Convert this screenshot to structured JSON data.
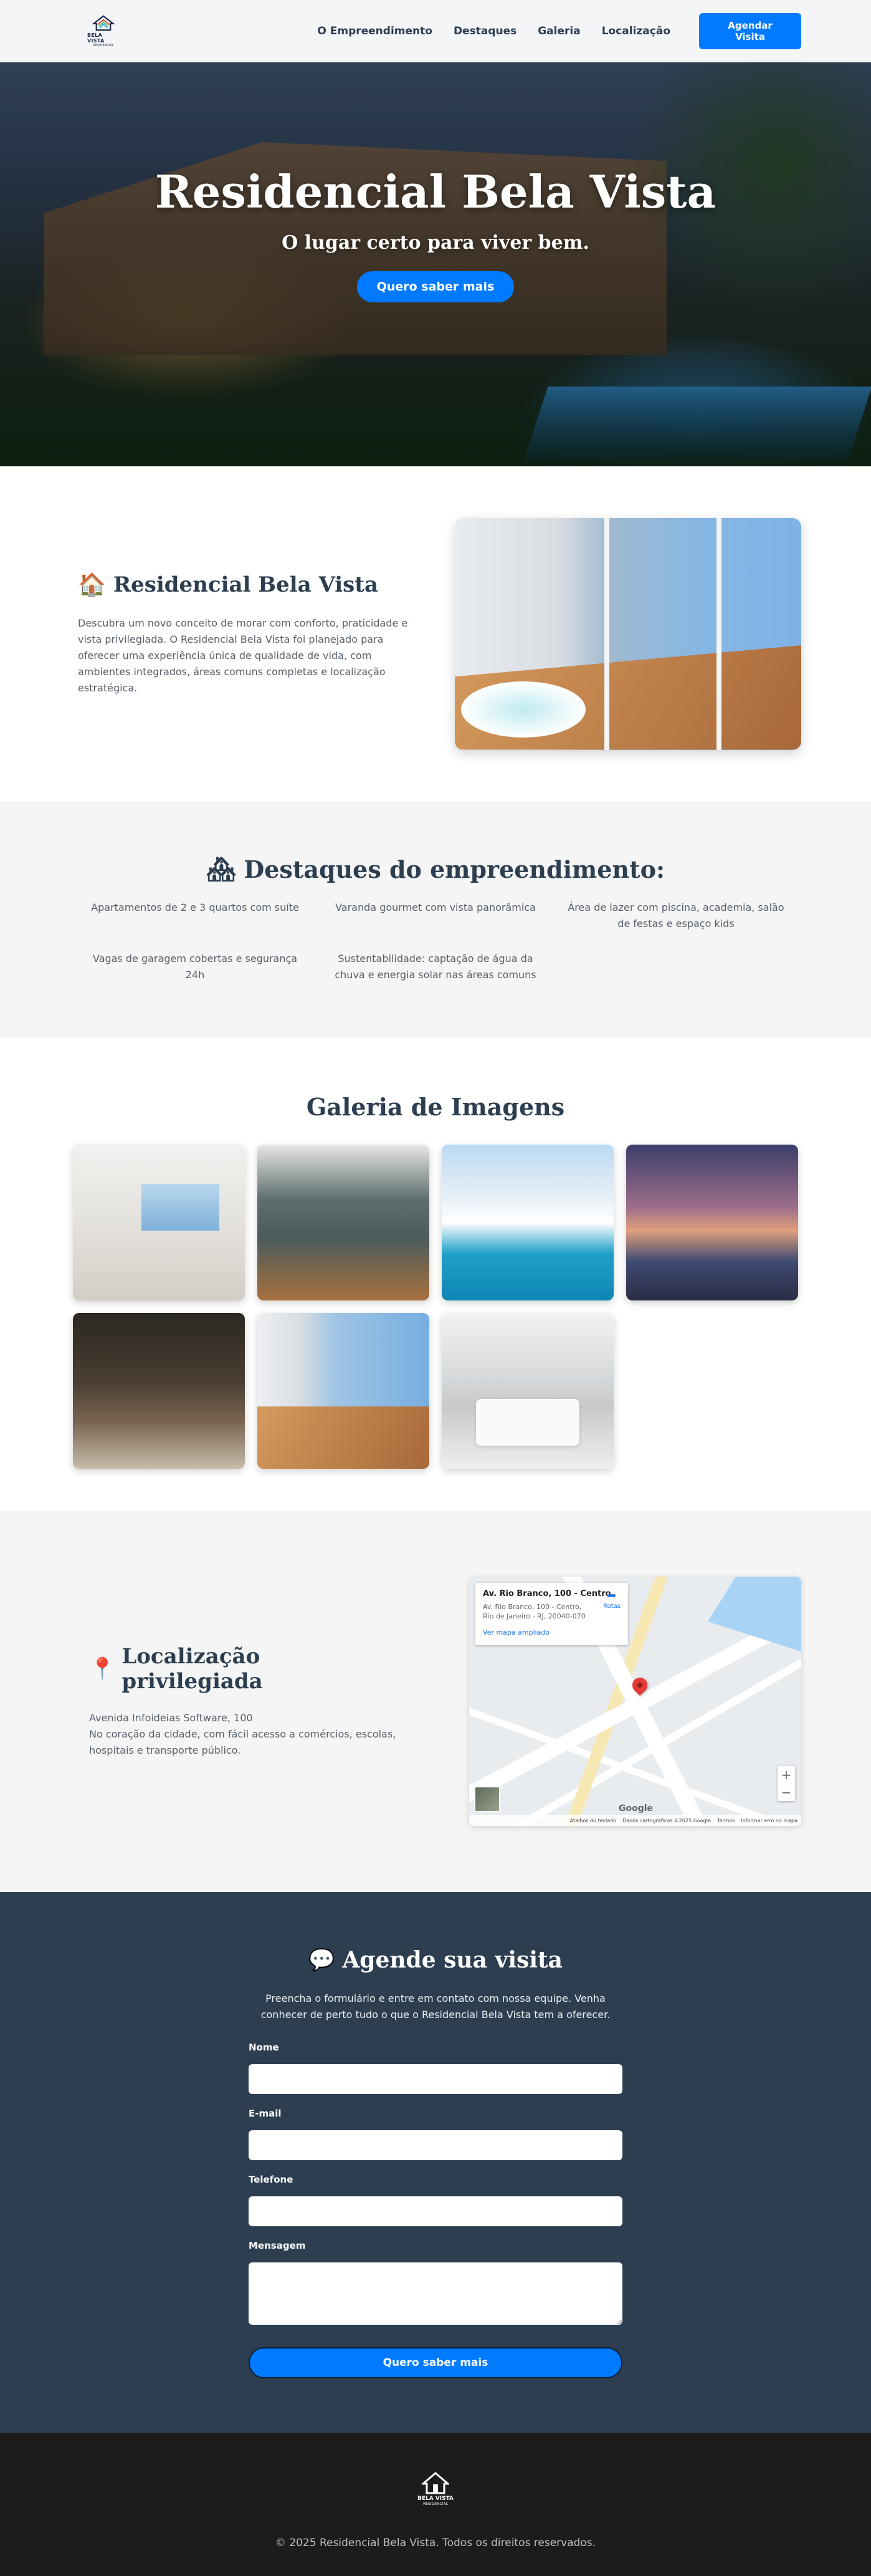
{
  "nav": {
    "logo_text": "BELA VISTA",
    "logo_sub": "RESIDENCIAL",
    "links": [
      "O Empreendimento",
      "Destaques",
      "Galeria",
      "Localização"
    ],
    "cta": "Agendar Visita"
  },
  "hero": {
    "title": "Residencial Bela Vista",
    "subtitle": "O lugar certo para viver bem.",
    "button": "Quero saber mais"
  },
  "about": {
    "icon": "house-emoji-icon",
    "title": "Residencial Bela Vista",
    "description": "Descubra um novo conceito de morar com conforto, praticidade e vista privilegiada. O Residencial Bela Vista foi planejado para oferecer uma experiência única de qualidade de vida, com ambientes integrados, áreas comuns completas e localização estratégica."
  },
  "highlights": {
    "icon": "buildings-emoji-icon",
    "title": "Destaques do empreendimento:",
    "items": [
      "Apartamentos de 2 e 3 quartos com suíte",
      "Varanda gourmet com vista panorâmica",
      "Área de lazer com piscina, academia, salão de festas e espaço kids",
      "Vagas de garagem cobertas e segurança 24h",
      "Sustentabilidade: captação de água da chuva e energia solar nas áreas comuns"
    ]
  },
  "gallery": {
    "title": "Galeria de Imagens",
    "images": 7
  },
  "location": {
    "icon": "pushpin-emoji-icon",
    "title": "Localização privilegiada",
    "address": "Avenida Infoideias Software, 100",
    "description": "No coração da cidade, com fácil acesso a comércios, escolas, hospitais e transporte público.",
    "map": {
      "card_title": "Av. Rio Branco, 100 - Centro",
      "card_address": "Av. Rio Branco, 100 - Centro, Rio de Janeiro - RJ, 20040-070",
      "card_link": "Ver mapa ampliado",
      "directions": "Rotas",
      "footer_items": [
        "Atalhos do teclado",
        "Dados cartográficos ©2025 Google",
        "Termos",
        "Informar erro no mapa"
      ],
      "brand": "Google"
    }
  },
  "contact": {
    "icon": "speech-bubble-emoji-icon",
    "title": "Agende sua visita",
    "description": "Preencha o formulário e entre em contato com nossa equipe. Venha conhecer de perto tudo o que o Residencial Bela Vista tem a oferecer.",
    "labels": {
      "name": "Nome",
      "email": "E-mail",
      "phone": "Telefone",
      "message": "Mensagem"
    },
    "submit": "Quero saber mais"
  },
  "footer": {
    "logo_text": "BELA VISTA",
    "logo_sub": "RESIDENCIAL",
    "copyright": "© 2025 Residencial Bela Vista. Todos os direitos reservados."
  },
  "colors": {
    "accent": "#007bff",
    "dark": "#2c3e50",
    "footer": "#1c1c1c"
  }
}
